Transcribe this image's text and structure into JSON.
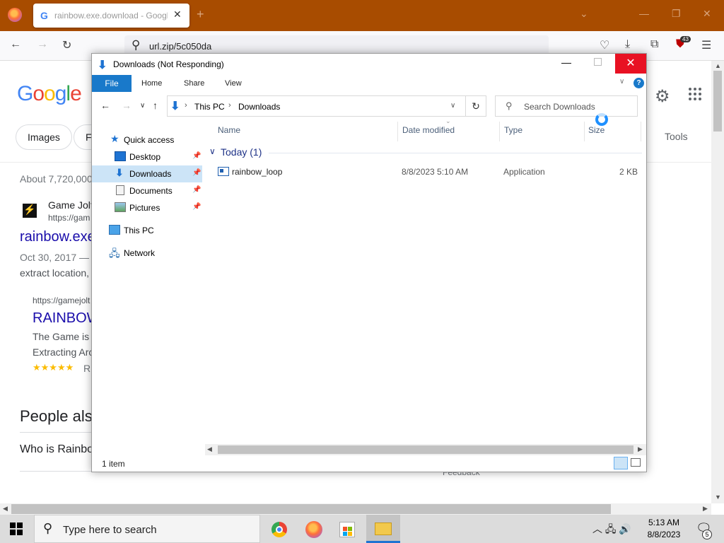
{
  "browser": {
    "tab_title": "rainbow.exe.download - Google",
    "tab_favicon": "G",
    "url": "url.zip/5c050da",
    "extension_badge": "43"
  },
  "google": {
    "logo": "Google",
    "chips": [
      "Images",
      "F"
    ],
    "tools": "Tools",
    "result_count": "About 7,720,000",
    "result1_site": "Game Jolt",
    "result1_url": "https://gam",
    "result1_title": "rainbow.exe",
    "result1_date": "Oct 30, 2017 —",
    "result1_snippet": "extract location,",
    "sub_url": "https://gamejolt",
    "sub_title": "RAINBOW",
    "sub_text1": "The Game is",
    "sub_text2": "Extracting Arc",
    "rating_stars": "★★★★★",
    "rating_suffix": "R",
    "people_also": "People als",
    "who_is": "Who is Rainbo",
    "feedback": "Feedback"
  },
  "explorer": {
    "title": "Downloads (Not Responding)",
    "ribbon_tabs": [
      "File",
      "Home",
      "Share",
      "View"
    ],
    "help": "?",
    "breadcrumb": [
      "This PC",
      "Downloads"
    ],
    "search_placeholder": "Search Downloads",
    "nav": {
      "quick_access": "Quick access",
      "desktop": "Desktop",
      "downloads": "Downloads",
      "documents": "Documents",
      "pictures": "Pictures",
      "this_pc": "This PC",
      "network": "Network"
    },
    "columns": [
      "Name",
      "Date modified",
      "Type",
      "Size"
    ],
    "group": "Today (1)",
    "file": {
      "name": "rainbow_loop",
      "date": "8/8/2023 5:10 AM",
      "type": "Application",
      "size": "2 KB"
    },
    "status": "1 item"
  },
  "taskbar": {
    "search_placeholder": "Type here to search",
    "time": "5:13 AM",
    "date": "8/8/2023",
    "notifications": "5"
  }
}
